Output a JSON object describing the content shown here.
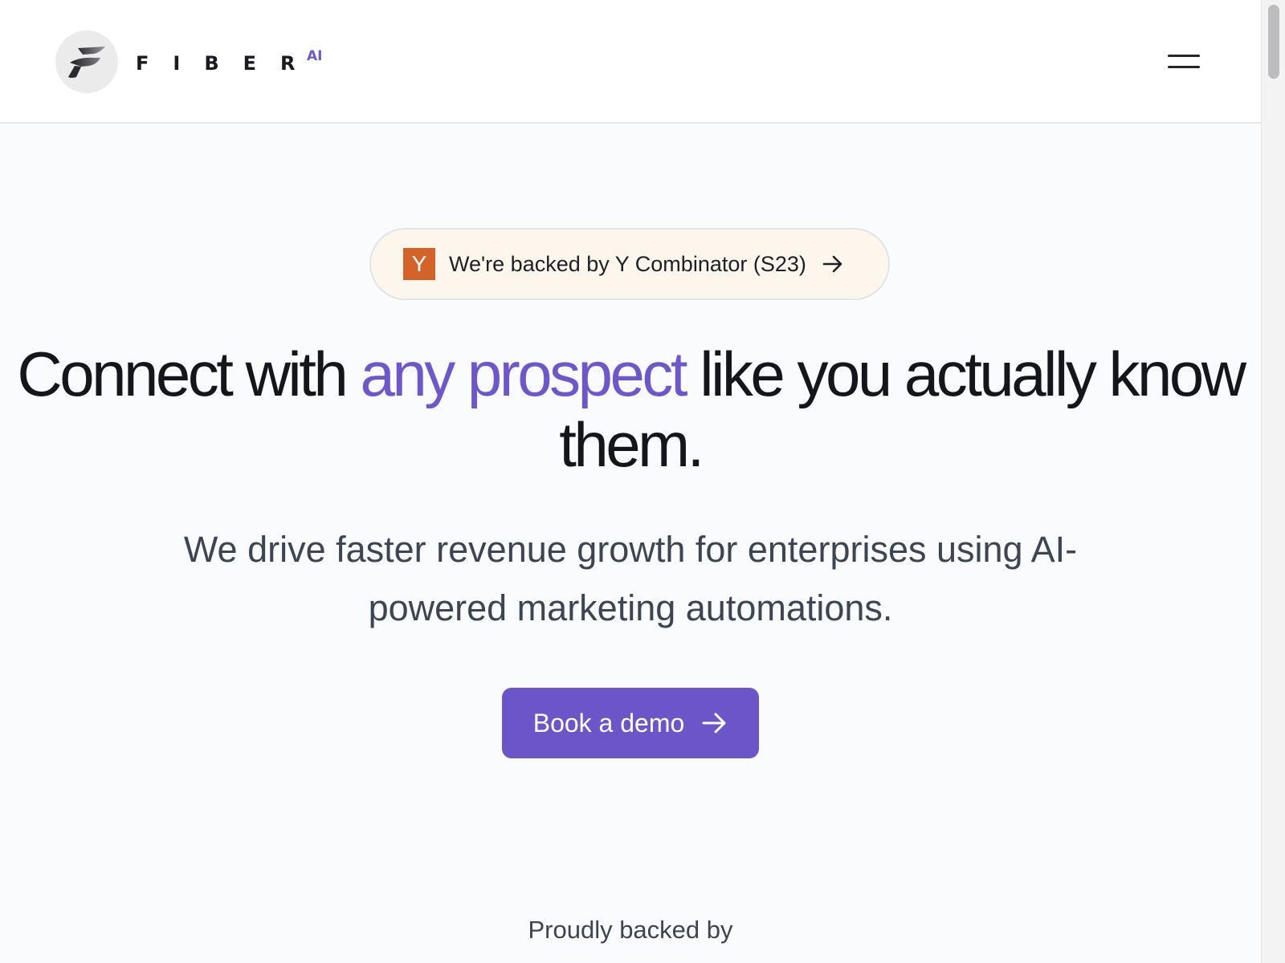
{
  "header": {
    "brand_name": "FIBER",
    "brand_suffix": "AI",
    "menu_icon": "hamburger-menu-icon"
  },
  "announcement": {
    "yc_logo_letter": "Y",
    "text": "We're backed by Y Combinator (S23)",
    "icon": "arrow-right-icon",
    "yc_color": "#d4632a"
  },
  "hero": {
    "headline_part1": "Connect with ",
    "headline_accent": "any prospect",
    "headline_part2": " like you actually know them.",
    "subheadline": "We drive faster revenue growth for enterprises using AI-powered marketing automations.",
    "cta_label": "Book a demo",
    "cta_icon": "arrow-right-icon"
  },
  "backers": {
    "heading": "Proudly backed by"
  },
  "colors": {
    "accent": "#6e57cc",
    "cta_background": "#6b55c9",
    "text_dark": "#15161c",
    "text_muted": "#3d4452"
  }
}
